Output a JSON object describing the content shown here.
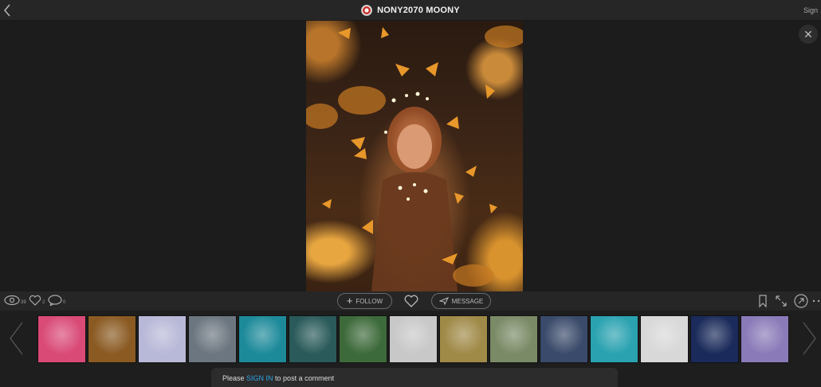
{
  "header": {
    "title": "NONY2070 MOONY",
    "sign_label": "Sign",
    "back_icon": "chevron-left-icon",
    "avatar_icon": "badge-avatar-icon"
  },
  "viewer": {
    "close_icon": "close-icon",
    "photo_subject": "girl-with-butterflies-and-fairy-lights"
  },
  "stats": {
    "views": "39",
    "likes": "2",
    "comments": "0"
  },
  "actions": {
    "follow_label": "FOLLOW",
    "message_label": "MESSAGE"
  },
  "thumbnails": [
    {
      "name": "thumb-1",
      "color": "#d94a77"
    },
    {
      "name": "thumb-2",
      "color": "#8a5a22"
    },
    {
      "name": "thumb-3",
      "color": "#b8b8d8"
    },
    {
      "name": "thumb-4",
      "color": "#6c7680"
    },
    {
      "name": "thumb-5",
      "color": "#1d8a9a"
    },
    {
      "name": "thumb-6",
      "color": "#2a5a5a"
    },
    {
      "name": "thumb-7",
      "color": "#3d6a3a"
    },
    {
      "name": "thumb-8",
      "color": "#c8c8c8"
    },
    {
      "name": "thumb-9",
      "color": "#a08a48"
    },
    {
      "name": "thumb-10",
      "color": "#7a8a66"
    },
    {
      "name": "thumb-11",
      "color": "#3a4a6a"
    },
    {
      "name": "thumb-12",
      "color": "#2aa2b0"
    },
    {
      "name": "thumb-13",
      "color": "#d8d8d8"
    },
    {
      "name": "thumb-14",
      "color": "#1a2a5a"
    },
    {
      "name": "thumb-15",
      "color": "#8a7ab8"
    }
  ],
  "comment": {
    "prefix": "Please ",
    "link": "SIGN IN",
    "suffix": " to post a comment"
  }
}
